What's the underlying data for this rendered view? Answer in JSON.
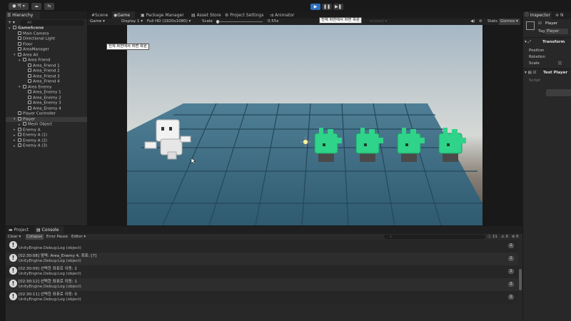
{
  "toolbar": {
    "account_label": "박 ▾",
    "cloud_icon": "cloud-icon",
    "collab_label": "⇆",
    "play_icon": "▶",
    "pause_icon": "❚❚",
    "step_icon": "▶❚"
  },
  "hierarchy": {
    "tab": "Hierarchy",
    "add_label": "+ ▾",
    "search_placeholder": "All",
    "items": [
      {
        "label": "GameScene",
        "depth": 0,
        "arrow": "▾",
        "kind": "scene"
      },
      {
        "label": "Main Camera",
        "depth": 1,
        "arrow": "",
        "kind": "obj"
      },
      {
        "label": "Directional Light",
        "depth": 1,
        "arrow": "",
        "kind": "obj"
      },
      {
        "label": "Floor",
        "depth": 1,
        "arrow": "",
        "kind": "obj"
      },
      {
        "label": "AreaManager",
        "depth": 1,
        "arrow": "",
        "kind": "obj"
      },
      {
        "label": "Area All",
        "depth": 1,
        "arrow": "▾",
        "kind": "obj"
      },
      {
        "label": "Area Friend",
        "depth": 2,
        "arrow": "▾",
        "kind": "obj"
      },
      {
        "label": "Area_Friend 1",
        "depth": 3,
        "arrow": "",
        "kind": "obj"
      },
      {
        "label": "Area_Friend 2",
        "depth": 3,
        "arrow": "",
        "kind": "obj"
      },
      {
        "label": "Area_Friend 3",
        "depth": 3,
        "arrow": "",
        "kind": "obj"
      },
      {
        "label": "Area_Friend 4",
        "depth": 3,
        "arrow": "",
        "kind": "obj"
      },
      {
        "label": "Area Enemy",
        "depth": 2,
        "arrow": "▾",
        "kind": "obj"
      },
      {
        "label": "Area_Enemy 1",
        "depth": 3,
        "arrow": "",
        "kind": "obj"
      },
      {
        "label": "Area_Enemy 2",
        "depth": 3,
        "arrow": "",
        "kind": "obj"
      },
      {
        "label": "Area_Enemy 3",
        "depth": 3,
        "arrow": "",
        "kind": "obj"
      },
      {
        "label": "Area_Enemy 4",
        "depth": 3,
        "arrow": "",
        "kind": "obj"
      },
      {
        "label": "Player Controller",
        "depth": 1,
        "arrow": "",
        "kind": "obj"
      },
      {
        "label": "Player",
        "depth": 1,
        "arrow": "▾",
        "kind": "obj",
        "selected": true
      },
      {
        "label": "Mesh Object",
        "depth": 2,
        "arrow": "▸",
        "kind": "obj"
      },
      {
        "label": "Enemy A",
        "depth": 1,
        "arrow": "▸",
        "kind": "obj"
      },
      {
        "label": "Enemy A (1)",
        "depth": 1,
        "arrow": "▸",
        "kind": "obj"
      },
      {
        "label": "Enemy A (2)",
        "depth": 1,
        "arrow": "▸",
        "kind": "obj"
      },
      {
        "label": "Enemy A (3)",
        "depth": 1,
        "arrow": "▸",
        "kind": "obj"
      }
    ]
  },
  "center_tabs": [
    "Scene",
    "Game",
    "Package Manager",
    "Asset Store",
    "Project Settings",
    "Animator"
  ],
  "game_bar": {
    "mode": "Game ▾",
    "display": "Display 1 ▾",
    "resolution": "Full HD (1920x1080) ▾",
    "scale_label": "Scale",
    "scale_value": "0.55x",
    "mute_icon": "speaker-icon",
    "stats": "Stats",
    "gizmos": "Gizmos ▾",
    "focused_label": "ocused ▾"
  },
  "game_tooltip": "전체 화면에서 화면 확원",
  "viewport_tooltip": "전체 화면에서 화면 확원",
  "bottom_tabs": [
    "Project",
    "Console"
  ],
  "console": {
    "clear": "Clear ▾",
    "collapse": "Collapse",
    "error_pause": "Error Pause",
    "editor": "Editor ▾",
    "search_placeholder": "",
    "counts": {
      "info": "11",
      "warn": "0",
      "error": "0"
    },
    "logs": [
      {
        "line1": "",
        "line2": "UnityEngine.Debug:Log (object)",
        "count": "1"
      },
      {
        "line1": "[02:30:08] 영역: Area_Enemy 4, 좌표: [7]",
        "line2": "UnityEngine.Debug:Log (object)",
        "count": "1"
      },
      {
        "line1": "[02:30:09] 선택한 좌표로 이동: 2",
        "line2": "UnityEngine.Debug:Log (object)",
        "count": "1"
      },
      {
        "line1": "[02:30:12] 선택한 좌표로 이동: 1",
        "line2": "UnityEngine.Debug:Log (object)",
        "count": "2"
      },
      {
        "line1": "[02:30:11] 선택한 좌표로 이동: 0",
        "line2": "UnityEngine.Debug:Log (object)",
        "count": "1"
      }
    ]
  },
  "inspector": {
    "tabs": [
      "Inspector",
      "N"
    ],
    "object_name": "Player",
    "tag_label": "Tag",
    "tag_value": "Player",
    "transform": "Transform",
    "fields": [
      "Position",
      "Rotation",
      "Scale"
    ],
    "component": "Test Player",
    "script_label": "Script"
  },
  "colors": {
    "accent": "#2f6fbf",
    "enemy": "#2fd38a",
    "floor": "#3f6c85"
  }
}
